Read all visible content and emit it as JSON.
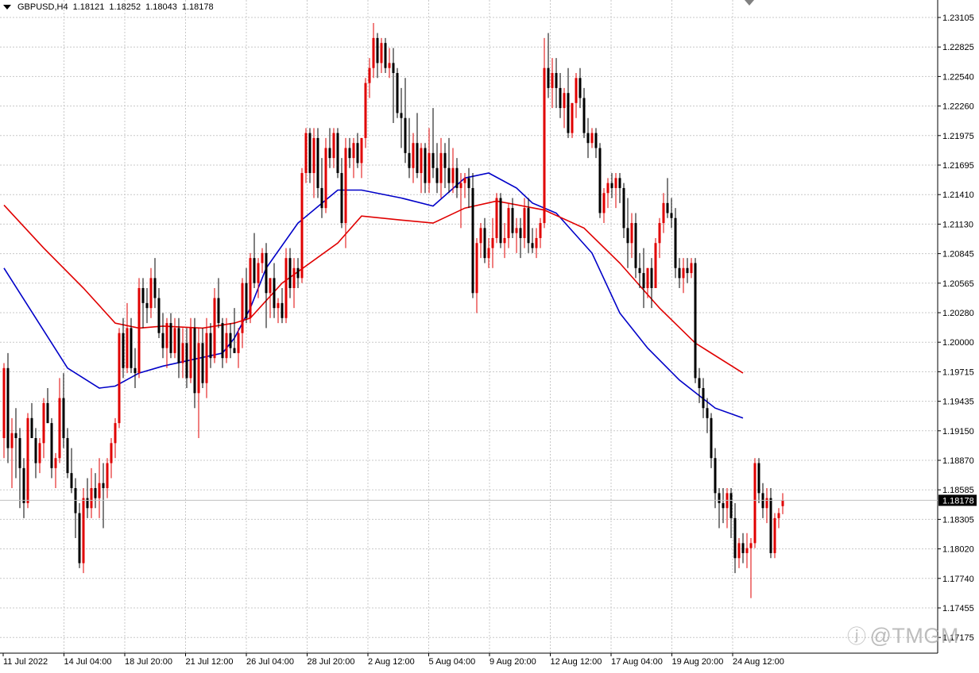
{
  "chart_data": {
    "type": "candlestick",
    "symbol": "GBPUSD",
    "timeframe": "H4",
    "title": "GBPUSD,H4",
    "ohlc_header": {
      "open": "1.18121",
      "high": "1.18252",
      "low": "1.18043",
      "close": "1.18178"
    },
    "current_price": "1.18178",
    "ylim": [
      1.1665,
      1.2318
    ],
    "y_ticks": [
      "1.23105",
      "1.22825",
      "1.22540",
      "1.22260",
      "1.21975",
      "1.21695",
      "1.21410",
      "1.21130",
      "1.20845",
      "1.20565",
      "1.20280",
      "1.20000",
      "1.19715",
      "1.19435",
      "1.19150",
      "1.18870",
      "1.18585",
      "1.18305",
      "1.18020",
      "1.17740",
      "1.17455",
      "1.17175"
    ],
    "x_ticks": [
      "11 Jul 2022",
      "14 Jul 04:00",
      "18 Jul 20:00",
      "21 Jul 12:00",
      "26 Jul 04:00",
      "28 Jul 20:00",
      "2 Aug 12:00",
      "5 Aug 04:00",
      "9 Aug 20:00",
      "12 Aug 12:00",
      "17 Aug 04:00",
      "19 Aug 20:00",
      "24 Aug 12:00"
    ],
    "grid": true,
    "bull_color": "#e00000",
    "bear_color": "#000000",
    "series": [
      {
        "color": "#0000c8",
        "x": [
          0,
          16,
          24,
          28,
          34,
          40,
          55,
          58,
          62,
          66,
          74,
          84,
          90,
          100,
          108,
          116,
          122,
          129,
          133,
          139,
          148,
          155,
          162,
          170,
          179,
          186
        ],
        "values": [
          1.205,
          1.195,
          1.193,
          1.1932,
          1.1945,
          1.1952,
          1.1965,
          1.198,
          1.201,
          1.205,
          1.2095,
          1.2128,
          1.2128,
          1.212,
          1.2112,
          1.214,
          1.2145,
          1.213,
          1.2115,
          1.2105,
          1.2065,
          1.2005,
          1.197,
          1.1938,
          1.191,
          1.19
        ]
      },
      {
        "color": "#e00000",
        "x": [
          0,
          10,
          20,
          28,
          34,
          40,
          50,
          58,
          62,
          70,
          84,
          90,
          100,
          108,
          116,
          124,
          136,
          146,
          155,
          165,
          174,
          186
        ],
        "values": [
          1.2113,
          1.207,
          1.203,
          1.1995,
          1.199,
          1.1992,
          1.199,
          1.1995,
          1.2,
          1.2035,
          1.2075,
          1.2102,
          1.2098,
          1.2095,
          1.211,
          1.2117,
          1.2108,
          1.209,
          1.2055,
          1.201,
          1.1975,
          1.1945
        ]
      }
    ],
    "candles": [
      [
        1.188,
        1.1955,
        1.186,
        1.195
      ],
      [
        1.195,
        1.1965,
        1.1855,
        1.187
      ],
      [
        1.187,
        1.19,
        1.183,
        1.1885
      ],
      [
        1.1885,
        1.191,
        1.184,
        1.188
      ],
      [
        1.188,
        1.189,
        1.181,
        1.185
      ],
      [
        1.185,
        1.186,
        1.18,
        1.1815
      ],
      [
        1.1815,
        1.1905,
        1.181,
        1.19
      ],
      [
        1.19,
        1.1915,
        1.188,
        1.188
      ],
      [
        1.188,
        1.189,
        1.184,
        1.1855
      ],
      [
        1.1855,
        1.188,
        1.1845,
        1.1875
      ],
      [
        1.1875,
        1.192,
        1.186,
        1.1915
      ],
      [
        1.1915,
        1.193,
        1.1895,
        1.1895
      ],
      [
        1.1895,
        1.19,
        1.184,
        1.185
      ],
      [
        1.185,
        1.1865,
        1.183,
        1.186
      ],
      [
        1.186,
        1.194,
        1.1855,
        1.192
      ],
      [
        1.192,
        1.1945,
        1.187,
        1.188
      ],
      [
        1.188,
        1.189,
        1.184,
        1.1845
      ],
      [
        1.1845,
        1.187,
        1.1825,
        1.183
      ],
      [
        1.183,
        1.184,
        1.178,
        1.1805
      ],
      [
        1.1805,
        1.1815,
        1.175,
        1.1755
      ],
      [
        1.1755,
        1.183,
        1.1745,
        1.182
      ],
      [
        1.182,
        1.184,
        1.18,
        1.181
      ],
      [
        1.181,
        1.185,
        1.18,
        1.183
      ],
      [
        1.183,
        1.1845,
        1.181,
        1.182
      ],
      [
        1.182,
        1.186,
        1.18,
        1.1835
      ],
      [
        1.1835,
        1.1855,
        1.179,
        1.183
      ],
      [
        1.183,
        1.186,
        1.182,
        1.1855
      ],
      [
        1.1855,
        1.188,
        1.184,
        1.1875
      ],
      [
        1.1875,
        1.19,
        1.186,
        1.1895
      ],
      [
        1.1895,
        1.199,
        1.189,
        1.1985
      ],
      [
        1.1985,
        1.2,
        1.194,
        1.195
      ],
      [
        1.195,
        1.2015,
        1.1945,
        1.199
      ],
      [
        1.199,
        1.2,
        1.1945,
        1.195
      ],
      [
        1.195,
        1.197,
        1.193,
        1.1945
      ],
      [
        1.1945,
        1.204,
        1.194,
        1.203
      ],
      [
        1.203,
        1.204,
        1.199,
        1.2015
      ],
      [
        1.2015,
        1.203,
        1.1995,
        1.201
      ],
      [
        1.201,
        1.205,
        1.2,
        1.204
      ],
      [
        1.204,
        1.206,
        1.201,
        1.202
      ],
      [
        1.202,
        1.203,
        1.198,
        1.1985
      ],
      [
        1.1985,
        1.2005,
        1.196,
        1.197
      ],
      [
        1.197,
        1.2,
        1.195,
        1.1995
      ],
      [
        1.1995,
        1.2005,
        1.196,
        1.1965
      ],
      [
        1.1965,
        1.2,
        1.196,
        1.199
      ],
      [
        1.199,
        1.2,
        1.194,
        1.1955
      ],
      [
        1.1955,
        1.199,
        1.194,
        1.1975
      ],
      [
        1.1975,
        1.199,
        1.193,
        1.194
      ],
      [
        1.194,
        1.2,
        1.1935,
        1.199
      ],
      [
        1.199,
        1.2,
        1.191,
        1.1925
      ],
      [
        1.1925,
        1.199,
        1.188,
        1.1975
      ],
      [
        1.1975,
        1.199,
        1.193,
        1.1935
      ],
      [
        1.1935,
        1.2,
        1.192,
        1.1985
      ],
      [
        1.1985,
        1.1995,
        1.195,
        1.196
      ],
      [
        1.196,
        1.203,
        1.1955,
        1.202
      ],
      [
        1.202,
        1.204,
        1.199,
        1.1995
      ],
      [
        1.1995,
        1.2,
        1.195,
        1.196
      ],
      [
        1.196,
        1.2,
        1.1955,
        1.1985
      ],
      [
        1.1985,
        1.1995,
        1.196,
        1.197
      ],
      [
        1.197,
        1.201,
        1.1965,
        1.1965
      ],
      [
        1.1965,
        1.199,
        1.195,
        1.1985
      ],
      [
        1.1985,
        1.204,
        1.197,
        1.2035
      ],
      [
        1.2035,
        1.205,
        1.1995,
        1.2
      ],
      [
        1.2,
        1.2065,
        1.1995,
        1.206
      ],
      [
        1.206,
        1.2085,
        1.203,
        1.2035
      ],
      [
        1.2035,
        1.206,
        1.202,
        1.2055
      ],
      [
        1.2055,
        1.207,
        1.2045,
        1.2065
      ],
      [
        1.2065,
        1.2075,
        1.199,
        1.2025
      ],
      [
        1.2025,
        1.204,
        1.2,
        1.204
      ],
      [
        1.204,
        1.2055,
        1.2,
        1.201
      ],
      [
        1.201,
        1.202,
        1.1995,
        1.2015
      ],
      [
        1.2015,
        1.203,
        1.1995,
        1.2
      ],
      [
        1.2,
        1.207,
        1.1995,
        1.206
      ],
      [
        1.206,
        1.207,
        1.202,
        1.203
      ],
      [
        1.203,
        1.206,
        1.201,
        1.205
      ],
      [
        1.205,
        1.206,
        1.203,
        1.204
      ],
      [
        1.204,
        1.215,
        1.2035,
        1.2145
      ],
      [
        1.2145,
        1.219,
        1.2135,
        1.2185
      ],
      [
        1.2185,
        1.219,
        1.2135,
        1.2145
      ],
      [
        1.2145,
        1.219,
        1.212,
        1.218
      ],
      [
        1.218,
        1.219,
        1.212,
        1.213
      ],
      [
        1.213,
        1.216,
        1.21,
        1.211
      ],
      [
        1.211,
        1.218,
        1.2105,
        1.217
      ],
      [
        1.217,
        1.219,
        1.215,
        1.216
      ],
      [
        1.216,
        1.219,
        1.215,
        1.2185
      ],
      [
        1.2185,
        1.219,
        1.214,
        1.2145
      ],
      [
        1.2145,
        1.216,
        1.209,
        1.2095
      ],
      [
        1.2095,
        1.218,
        1.207,
        1.217
      ],
      [
        1.217,
        1.218,
        1.215,
        1.216
      ],
      [
        1.216,
        1.218,
        1.214,
        1.2175
      ],
      [
        1.2175,
        1.2185,
        1.215,
        1.2155
      ],
      [
        1.2155,
        1.218,
        1.214,
        1.218
      ],
      [
        1.218,
        1.224,
        1.217,
        1.2235
      ],
      [
        1.2235,
        1.226,
        1.222,
        1.225
      ],
      [
        1.225,
        1.2295,
        1.224,
        1.228
      ],
      [
        1.228,
        1.2285,
        1.224,
        1.2255
      ],
      [
        1.2255,
        1.228,
        1.2245,
        1.2275
      ],
      [
        1.2275,
        1.228,
        1.2245,
        1.225
      ],
      [
        1.225,
        1.227,
        1.224,
        1.2255
      ],
      [
        1.2255,
        1.227,
        1.2195,
        1.2245
      ],
      [
        1.2245,
        1.225,
        1.22,
        1.2205
      ],
      [
        1.2205,
        1.223,
        1.217,
        1.22
      ],
      [
        1.22,
        1.224,
        1.2155,
        1.2165
      ],
      [
        1.2165,
        1.22,
        1.214,
        1.215
      ],
      [
        1.215,
        1.2185,
        1.2135,
        1.2175
      ],
      [
        1.2175,
        1.2205,
        1.214,
        1.2145
      ],
      [
        1.2145,
        1.2175,
        1.2125,
        1.217
      ],
      [
        1.217,
        1.2175,
        1.2125,
        1.2135
      ],
      [
        1.2135,
        1.219,
        1.2125,
        1.2165
      ],
      [
        1.2165,
        1.221,
        1.214,
        1.215
      ],
      [
        1.215,
        1.2175,
        1.2125,
        1.2135
      ],
      [
        1.2135,
        1.218,
        1.212,
        1.2165
      ],
      [
        1.2165,
        1.2175,
        1.213,
        1.215
      ],
      [
        1.215,
        1.218,
        1.2125,
        1.2135
      ],
      [
        1.2135,
        1.217,
        1.2125,
        1.215
      ],
      [
        1.215,
        1.216,
        1.212,
        1.213
      ],
      [
        1.213,
        1.2145,
        1.209,
        1.2135
      ],
      [
        1.2135,
        1.2145,
        1.212,
        1.214
      ],
      [
        1.214,
        1.215,
        1.211,
        1.213
      ],
      [
        1.213,
        1.2145,
        1.202,
        1.2025
      ],
      [
        1.2025,
        1.208,
        1.2005,
        1.2075
      ],
      [
        1.2075,
        1.2095,
        1.206,
        1.209
      ],
      [
        1.209,
        1.21,
        1.2055,
        1.206
      ],
      [
        1.206,
        1.208,
        1.205,
        1.207
      ],
      [
        1.207,
        1.21,
        1.205,
        1.208
      ],
      [
        1.208,
        1.2125,
        1.2075,
        1.212
      ],
      [
        1.212,
        1.2125,
        1.207,
        1.2075
      ],
      [
        1.2075,
        1.2095,
        1.206,
        1.208
      ],
      [
        1.208,
        1.2115,
        1.207,
        1.211
      ],
      [
        1.211,
        1.212,
        1.208,
        1.2085
      ],
      [
        1.2085,
        1.21,
        1.2065,
        1.209
      ],
      [
        1.209,
        1.21,
        1.206,
        1.208
      ],
      [
        1.208,
        1.212,
        1.207,
        1.211
      ],
      [
        1.211,
        1.212,
        1.2065,
        1.2075
      ],
      [
        1.2075,
        1.209,
        1.2065,
        1.207
      ],
      [
        1.207,
        1.209,
        1.206,
        1.208
      ],
      [
        1.208,
        1.21,
        1.207,
        1.2095
      ],
      [
        1.2095,
        1.228,
        1.209,
        1.225
      ],
      [
        1.225,
        1.2285,
        1.222,
        1.223
      ],
      [
        1.223,
        1.226,
        1.221,
        1.2245
      ],
      [
        1.2245,
        1.226,
        1.221,
        1.223
      ],
      [
        1.223,
        1.2245,
        1.22,
        1.221
      ],
      [
        1.221,
        1.223,
        1.219,
        1.2225
      ],
      [
        1.2225,
        1.225,
        1.218,
        1.2185
      ],
      [
        1.2185,
        1.2215,
        1.218,
        1.2215
      ],
      [
        1.2215,
        1.2245,
        1.22,
        1.224
      ],
      [
        1.224,
        1.225,
        1.221,
        1.222
      ],
      [
        1.222,
        1.223,
        1.218,
        1.2185
      ],
      [
        1.2185,
        1.22,
        1.216,
        1.2175
      ],
      [
        1.2175,
        1.219,
        1.217,
        1.2185
      ],
      [
        1.2185,
        1.219,
        1.216,
        1.217
      ],
      [
        1.217,
        1.2175,
        1.21,
        1.2105
      ],
      [
        1.2105,
        1.213,
        1.2095,
        1.2125
      ],
      [
        1.2125,
        1.214,
        1.211,
        1.2135
      ],
      [
        1.2135,
        1.2145,
        1.212,
        1.213
      ],
      [
        1.213,
        1.2145,
        1.211,
        1.214
      ],
      [
        1.214,
        1.2145,
        1.2115,
        1.213
      ],
      [
        1.213,
        1.2135,
        1.208,
        1.209
      ],
      [
        1.209,
        1.212,
        1.205,
        1.2075
      ],
      [
        1.2075,
        1.2105,
        1.206,
        1.2095
      ],
      [
        1.2095,
        1.2105,
        1.204,
        1.205
      ],
      [
        1.205,
        1.2065,
        1.203,
        1.2045
      ],
      [
        1.2045,
        1.207,
        1.201,
        1.203
      ],
      [
        1.203,
        1.205,
        1.202,
        1.205
      ],
      [
        1.205,
        1.206,
        1.201,
        1.203
      ],
      [
        1.203,
        1.208,
        1.203,
        1.2075
      ],
      [
        1.2075,
        1.21,
        1.206,
        1.2095
      ],
      [
        1.2095,
        1.2125,
        1.2085,
        1.2115
      ],
      [
        1.2115,
        1.214,
        1.21,
        1.2105
      ],
      [
        1.2105,
        1.212,
        1.209,
        1.21
      ],
      [
        1.21,
        1.211,
        1.204,
        1.205
      ],
      [
        1.205,
        1.206,
        1.203,
        1.204
      ],
      [
        1.204,
        1.206,
        1.2025,
        1.205
      ],
      [
        1.205,
        1.206,
        1.2035,
        1.2045
      ],
      [
        1.2045,
        1.206,
        1.204,
        1.2055
      ],
      [
        1.2055,
        1.206,
        1.1935,
        1.194
      ],
      [
        1.194,
        1.195,
        1.1915,
        1.193
      ],
      [
        1.193,
        1.194,
        1.19,
        1.191
      ],
      [
        1.191,
        1.192,
        1.1885,
        1.19
      ],
      [
        1.19,
        1.1905,
        1.185,
        1.186
      ],
      [
        1.186,
        1.187,
        1.181,
        1.1825
      ],
      [
        1.1825,
        1.183,
        1.179,
        1.1815
      ],
      [
        1.1815,
        1.183,
        1.1795,
        1.181
      ],
      [
        1.181,
        1.183,
        1.179,
        1.1825
      ],
      [
        1.1825,
        1.183,
        1.178,
        1.18
      ],
      [
        1.18,
        1.1815,
        1.1745,
        1.176
      ],
      [
        1.176,
        1.178,
        1.175,
        1.1775
      ],
      [
        1.1775,
        1.1785,
        1.1755,
        1.1765
      ],
      [
        1.1765,
        1.1785,
        1.175,
        1.177
      ],
      [
        1.177,
        1.178,
        1.172,
        1.1775
      ],
      [
        1.1775,
        1.186,
        1.177,
        1.1855
      ],
      [
        1.1855,
        1.186,
        1.1815,
        1.1825
      ],
      [
        1.1825,
        1.1835,
        1.18,
        1.181
      ],
      [
        1.181,
        1.183,
        1.1795,
        1.182
      ],
      [
        1.182,
        1.183,
        1.176,
        1.1765
      ],
      [
        1.1765,
        1.1805,
        1.176,
        1.18
      ],
      [
        1.18,
        1.181,
        1.179,
        1.1805
      ],
      [
        1.1812,
        1.1825,
        1.1804,
        1.1818
      ]
    ]
  }
}
